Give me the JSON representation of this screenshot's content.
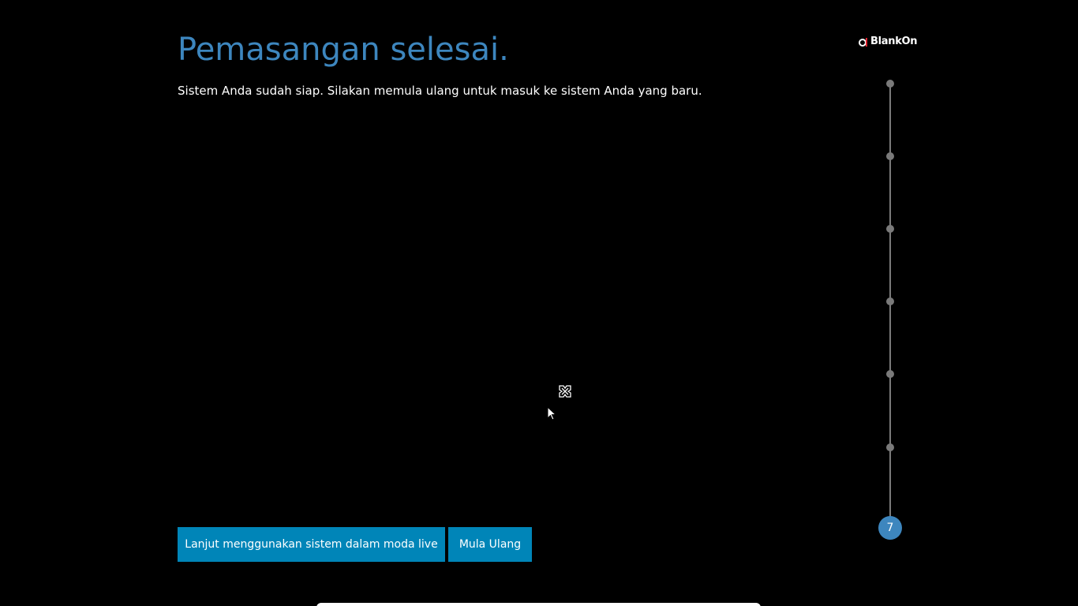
{
  "page": {
    "title": "Pemasangan selesai.",
    "subtitle": "Sistem Anda sudah siap. Silakan memula ulang untuk masuk ke sistem Anda yang baru."
  },
  "brand": {
    "logo_text": "BlankOn",
    "accent_color": "#3d86be",
    "logo_mark_color": "#e0232f"
  },
  "stepper": {
    "total_steps": 7,
    "current_step": 7,
    "current_step_label": "7"
  },
  "actions": {
    "continue_live_label": "Lanjut menggunakan sistem dalam moda live",
    "restart_label": "Mula Ulang",
    "button_color": "#0085b8"
  },
  "icons": {
    "busy_cursor": "busy-cursor-icon",
    "pointer_cursor": "mouse-pointer-icon"
  }
}
